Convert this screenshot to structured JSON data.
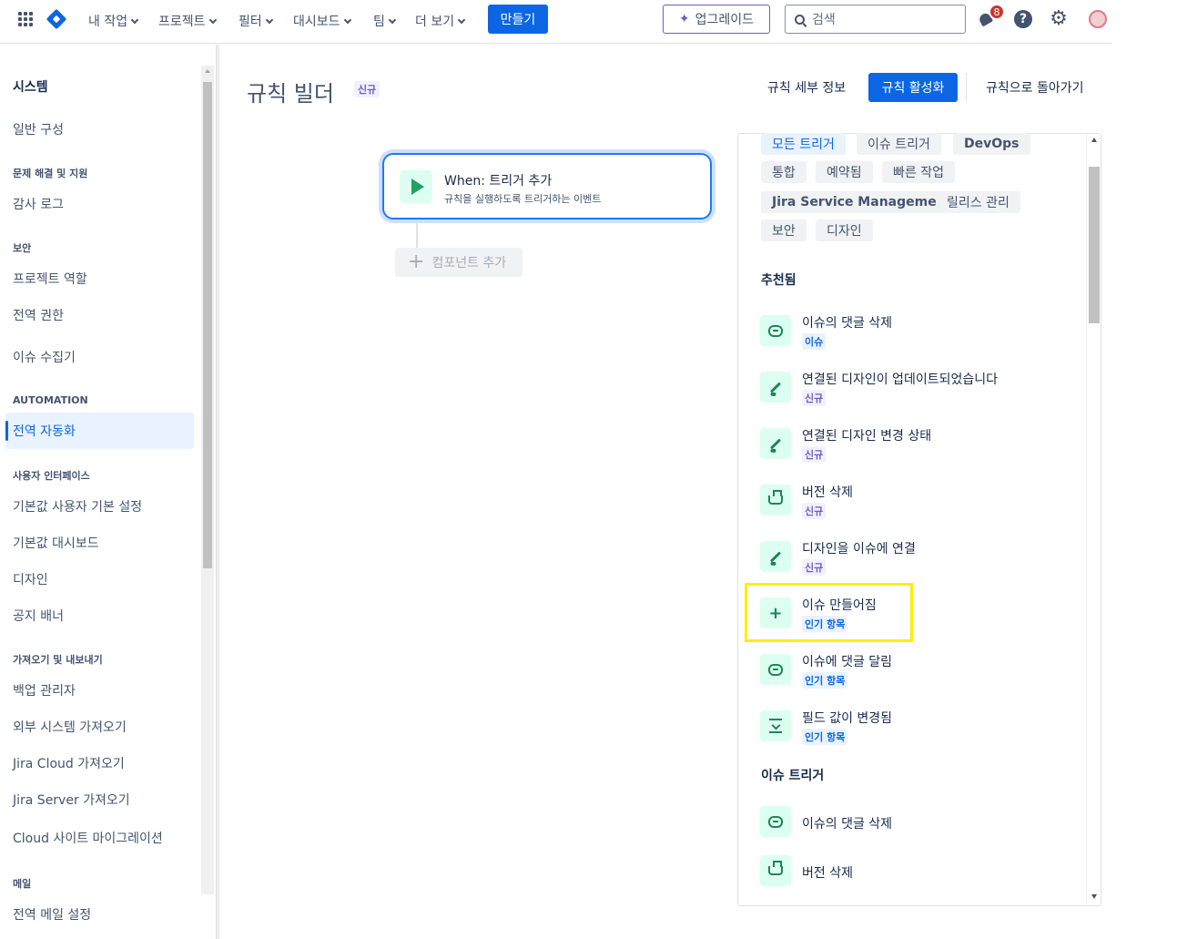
{
  "topnav": {
    "items": [
      "내 작업",
      "프로젝트",
      "필터",
      "대시보드",
      "팀",
      "더 보기"
    ],
    "create_label": "만들기",
    "upgrade_label": "업그레이드",
    "search_placeholder": "검색",
    "notification_count": "8",
    "help_label": "?"
  },
  "sidebar": {
    "title": "시스템",
    "sections": {
      "troubleshooting": "문제 해결 및 지원",
      "security": "보안",
      "automation": "AUTOMATION",
      "ui": "사용자 인터페이스",
      "import_export": "가져오기 및 내보내기",
      "mail": "메일"
    },
    "items": {
      "general": "일반 구성",
      "audit_log": "감사 로그",
      "project_roles": "프로젝트 역할",
      "global_permissions": "전역 권한",
      "issue_collectors": "이슈 수집기",
      "global_automation": "전역 자동화",
      "default_user_prefs": "기본값 사용자 기본 설정",
      "default_dashboard": "기본값 대시보드",
      "design": "디자인",
      "announcement_banner": "공지 배너",
      "backup_manager": "백업 관리자",
      "external_import": "외부 시스템 가져오기",
      "jira_cloud_import": "Jira Cloud 가져오기",
      "jira_server_import": "Jira Server 가져오기",
      "cloud_migration": "Cloud 사이트 마이그레이션",
      "global_mail": "전역 메일 설정"
    }
  },
  "header": {
    "title": "규칙 빌더",
    "badge": "신규",
    "details_label": "규칙 세부 정보",
    "activate_label": "규칙 활성화",
    "back_label": "규칙으로 돌아가기"
  },
  "builder": {
    "trigger_prefix": "When:",
    "trigger_title": "트리거 추가",
    "trigger_subtitle": "규칙을 실행하도록 트리거하는 이벤트",
    "add_component": "컴포넌트 추가"
  },
  "panel": {
    "chips": [
      "모든 트리거",
      "이슈 트리거",
      "DevOps",
      "통합",
      "예약됨",
      "빠른 작업",
      "Jira Service Management",
      "릴리스 관리",
      "보안",
      "디자인"
    ],
    "recommended_heading": "추천됨",
    "recommended": [
      {
        "label": "이슈의 댓글 삭제",
        "badge": "이슈",
        "icon": "comment-icon"
      },
      {
        "label": "연결된 디자인이 업데이트되었습니다",
        "badge": "신규",
        "icon": "brush-icon"
      },
      {
        "label": "연결된 디자인 변경 상태",
        "badge": "신규",
        "icon": "brush-icon"
      },
      {
        "label": "버전 삭제",
        "badge": "신규",
        "icon": "ship-icon"
      },
      {
        "label": "디자인을 이슈에 연결",
        "badge": "신규",
        "icon": "brush-icon"
      },
      {
        "label": "이슈 만들어짐",
        "badge": "인기 항목",
        "icon": "plus-icon"
      },
      {
        "label": "이슈에 댓글 달림",
        "badge": "인기 항목",
        "icon": "comment-icon"
      },
      {
        "label": "필드 값이 변경됨",
        "badge": "인기 항목",
        "icon": "download-icon"
      }
    ],
    "issue_heading": "이슈 트리거",
    "issue_triggers": [
      {
        "label": "이슈의 댓글 삭제",
        "icon": "comment-icon"
      },
      {
        "label": "버전 삭제",
        "icon": "ship-icon"
      }
    ]
  }
}
